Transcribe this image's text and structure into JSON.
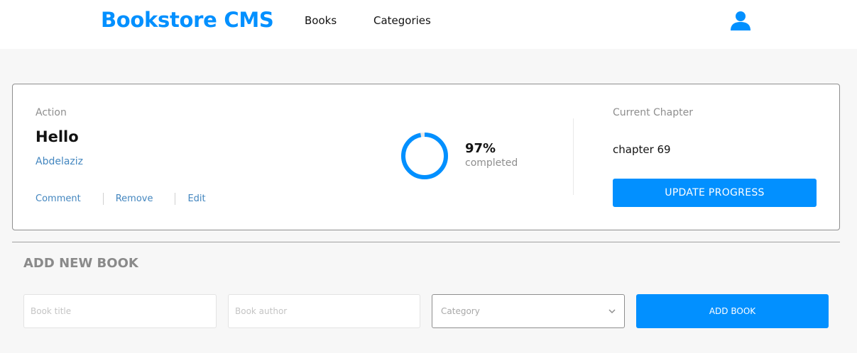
{
  "header": {
    "logo": "Bookstore CMS",
    "nav": [
      {
        "label": "Books"
      },
      {
        "label": "Categories"
      }
    ],
    "user_icon": "user-icon"
  },
  "book": {
    "genre": "Action",
    "title": "Hello",
    "author": "Abdelaziz",
    "actions": {
      "comment": "Comment",
      "remove": "Remove",
      "edit": "Edit"
    },
    "progress": {
      "percent": 97,
      "percent_label": "97%",
      "completed_label": "completed"
    },
    "current_chapter_label": "Current Chapter",
    "current_chapter": "chapter 69",
    "update_button": "UPDATE PROGRESS"
  },
  "add_form": {
    "title": "ADD NEW BOOK",
    "title_placeholder": "Book title",
    "author_placeholder": "Book author",
    "category_placeholder": "Category",
    "submit": "ADD BOOK"
  },
  "colors": {
    "accent": "#0290ff",
    "link": "#4386bf",
    "muted": "#8e8e8e",
    "background": "#f7f7f7"
  }
}
